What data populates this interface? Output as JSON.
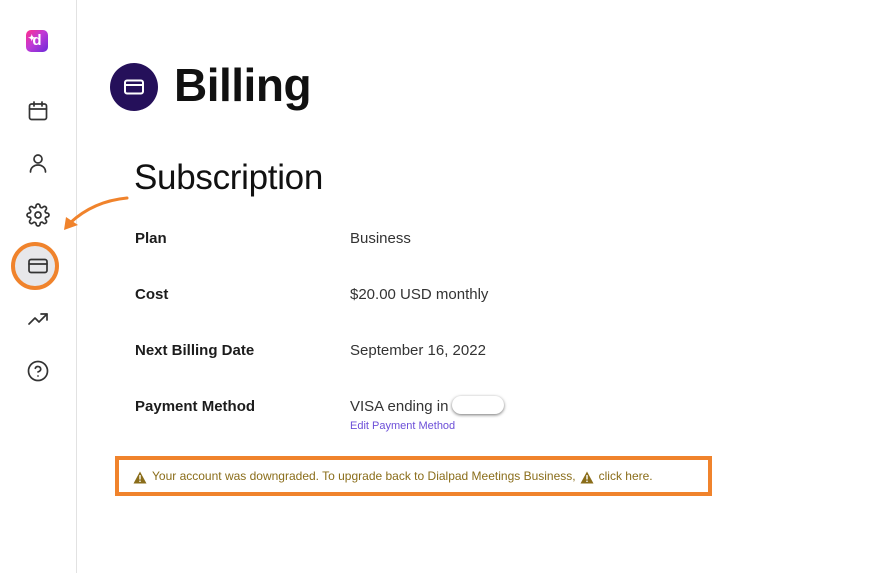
{
  "sidebar": {
    "logo_letter": "d",
    "items": [
      {
        "icon": "calendar-icon"
      },
      {
        "icon": "user-icon"
      },
      {
        "icon": "gear-icon"
      },
      {
        "icon": "credit-card-icon",
        "active": true
      },
      {
        "icon": "trending-up-icon"
      },
      {
        "icon": "help-icon"
      }
    ],
    "highlight_color": "#f0832c"
  },
  "header": {
    "title": "Billing",
    "icon": "credit-card-icon",
    "icon_bg": "#25105a"
  },
  "subscription": {
    "title": "Subscription",
    "rows": [
      {
        "label": "Plan",
        "value": "Business"
      },
      {
        "label": "Cost",
        "value": "$20.00 USD monthly"
      },
      {
        "label": "Next Billing Date",
        "value": "September 16, 2022"
      },
      {
        "label": "Payment Method",
        "value": "VISA ending in"
      }
    ],
    "edit_payment_label": "Edit Payment Method"
  },
  "warning": {
    "text_before": "Your account was downgraded. To upgrade back to Dialpad Meetings Business,",
    "link_text": "click here.",
    "color": "#8a6d1a"
  }
}
